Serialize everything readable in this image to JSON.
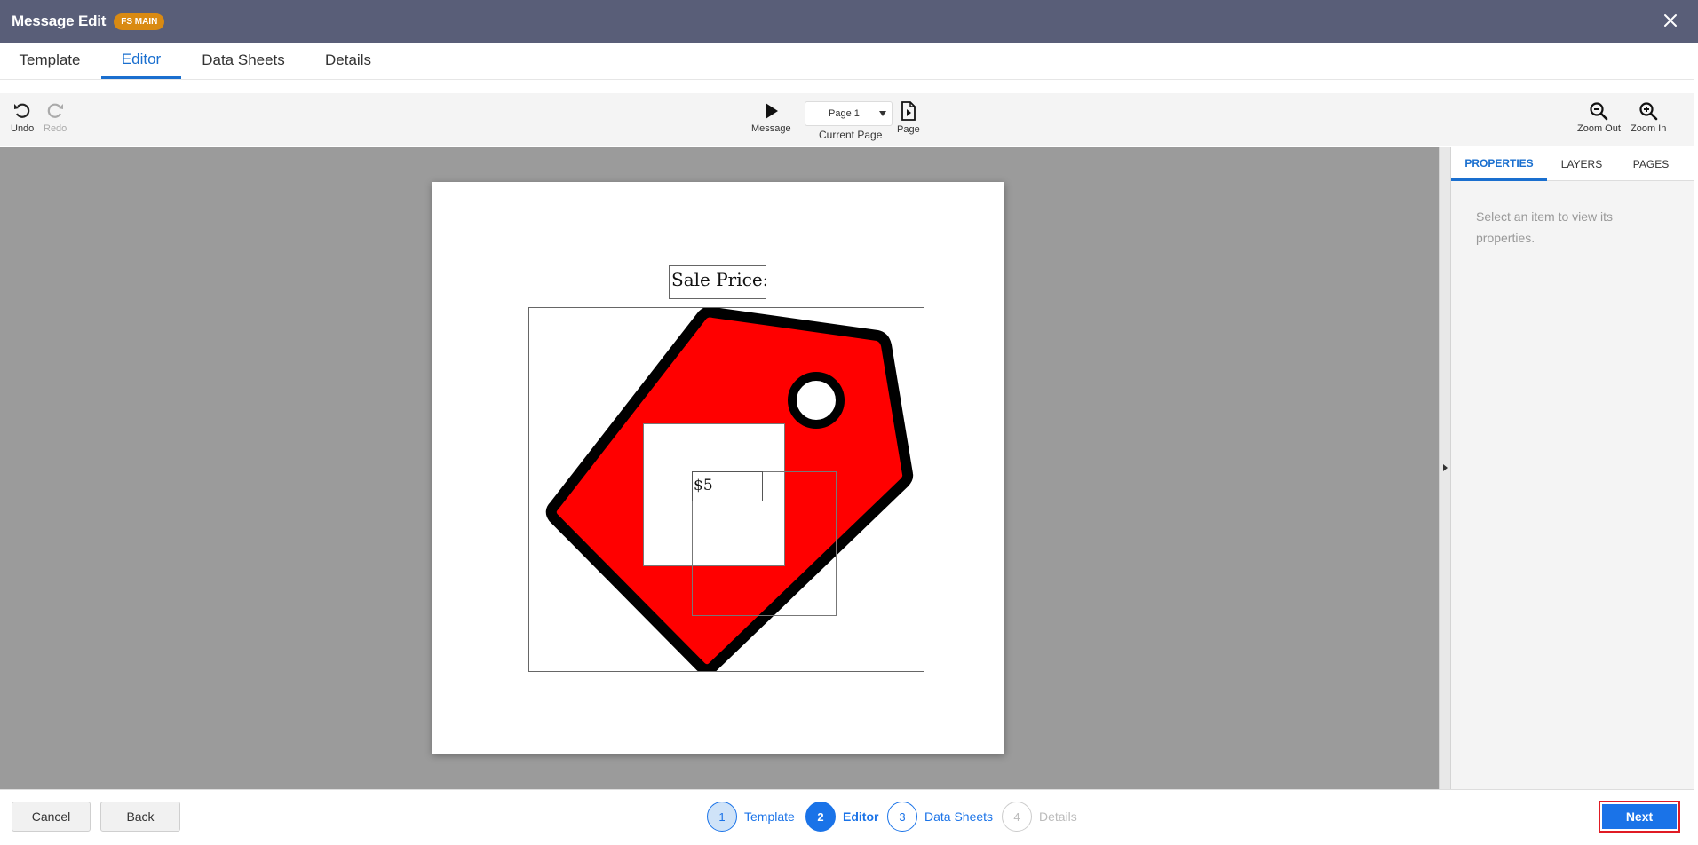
{
  "window": {
    "title": "Message Edit",
    "badge": "FS MAIN"
  },
  "tabs": [
    {
      "label": "Template",
      "active": false
    },
    {
      "label": "Editor",
      "active": true
    },
    {
      "label": "Data Sheets",
      "active": false
    },
    {
      "label": "Details",
      "active": false
    }
  ],
  "toolbar": {
    "undo_label": "Undo",
    "redo_label": "Redo",
    "message_label": "Message",
    "page_select_value": "Page 1",
    "current_page_label": "Current Page",
    "page_label": "Page",
    "zoom_out_label": "Zoom Out",
    "zoom_in_label": "Zoom In"
  },
  "canvas": {
    "sale_label": "Sale Price:",
    "price_text": "$5",
    "tag_color": "#ff0000",
    "tag_outline_color": "#000000"
  },
  "panel": {
    "tabs": [
      "PROPERTIES",
      "LAYERS",
      "PAGES"
    ],
    "active_tab": "PROPERTIES",
    "empty_message": "Select an item to view its properties."
  },
  "footer": {
    "cancel_label": "Cancel",
    "back_label": "Back",
    "next_label": "Next",
    "steps": [
      {
        "number": "1",
        "label": "Template",
        "state": "done"
      },
      {
        "number": "2",
        "label": "Editor",
        "state": "current"
      },
      {
        "number": "3",
        "label": "Data Sheets",
        "state": "upcoming"
      },
      {
        "number": "4",
        "label": "Details",
        "state": "todo"
      }
    ]
  },
  "colors": {
    "titlebar": "#595e78",
    "badge": "#d98a12",
    "accent": "#1a73e8",
    "highlight": "#e01b24"
  }
}
